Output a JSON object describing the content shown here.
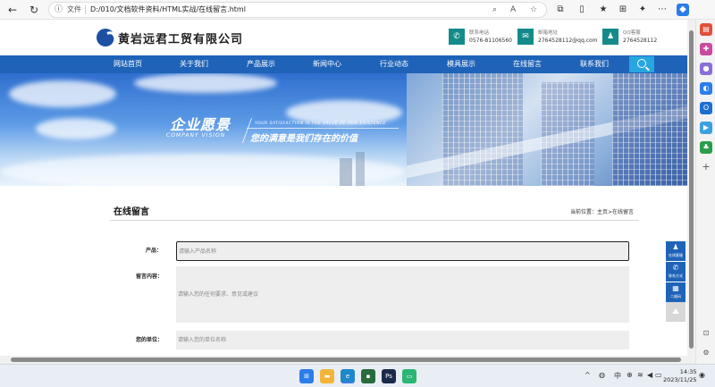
{
  "browser": {
    "file_label": "文件",
    "url": "D:/010/文档软件资料/HTML实战/在线留言.html"
  },
  "site": {
    "logo_text": "黄岩远君工贸有限公司",
    "contacts": [
      {
        "label": "联系电话",
        "value": "0576-81106560",
        "icon": "phone-icon"
      },
      {
        "label": "邮箱地址",
        "value": "2764528112@qq.com",
        "icon": "mail-icon"
      },
      {
        "label": "QQ客服",
        "value": "2764528112",
        "icon": "qq-icon"
      }
    ]
  },
  "nav": {
    "items": [
      "网站首页",
      "关于我们",
      "产品展示",
      "新闻中心",
      "行业动态",
      "模具展示",
      "在线留言",
      "联系我们"
    ]
  },
  "banner": {
    "title": "企业愿景",
    "title_en": "COMPANY VISION",
    "line_en": "YOUR SATISFACTION IS THE VALUE OF OUR EXISTENCE",
    "slogan": "您的满意是我们存在的价值"
  },
  "content": {
    "title": "在线留言",
    "breadcrumb": "当前位置：主页>在线留言"
  },
  "form": {
    "product_label": "产品：",
    "product_placeholder": "请输入产品名称",
    "message_label": "留言内容：",
    "message_placeholder": "请输入您的任何要求、意见或建议",
    "unit_label": "您的单位：",
    "unit_placeholder": "请输入您的单位名称"
  },
  "float_toolbar": {
    "items": [
      {
        "label": "在线客服",
        "icon": "qq-icon"
      },
      {
        "label": "联系方式",
        "icon": "phone-icon"
      },
      {
        "label": "二维码",
        "icon": "qrcode-icon"
      }
    ]
  },
  "taskbar": {
    "ime": "中",
    "time": "14:35",
    "date": "2023/11/25"
  },
  "colors": {
    "nav_blue": "#1e63b8",
    "contact_teal": "#148a8a",
    "search_cyan": "#27a6e0"
  }
}
